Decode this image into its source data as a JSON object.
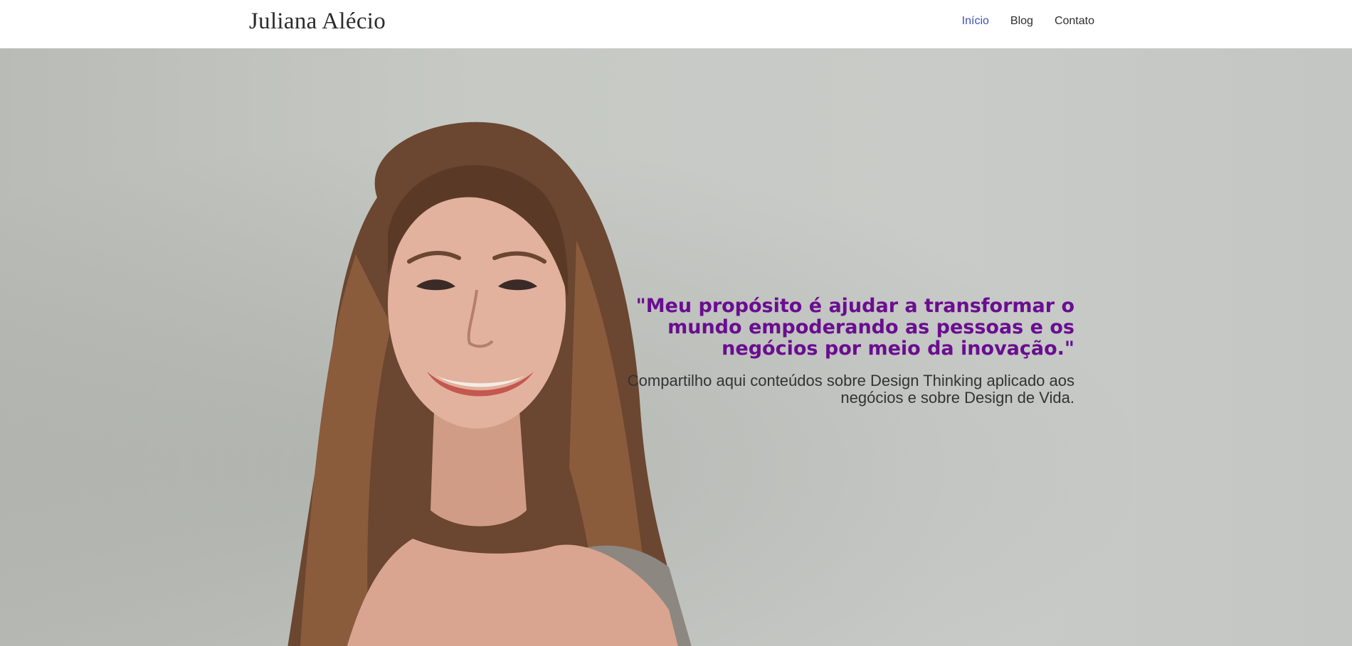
{
  "header": {
    "brand": "Juliana Alécio",
    "nav": [
      {
        "label": "Início",
        "active": true
      },
      {
        "label": "Blog",
        "active": false
      },
      {
        "label": "Contato",
        "active": false
      }
    ]
  },
  "hero": {
    "quote": "\"Meu propósito é ajudar a transformar o mundo empoderando as pessoas e os negócios por meio da inovação.\"",
    "subtitle": "Compartilho aqui conteúdos sobre Design Thinking aplicado aos negócios e sobre Design de Vida."
  },
  "colors": {
    "accent": "#3f51b5",
    "quote": "#6a0d91",
    "background": "#c6c9c4"
  }
}
